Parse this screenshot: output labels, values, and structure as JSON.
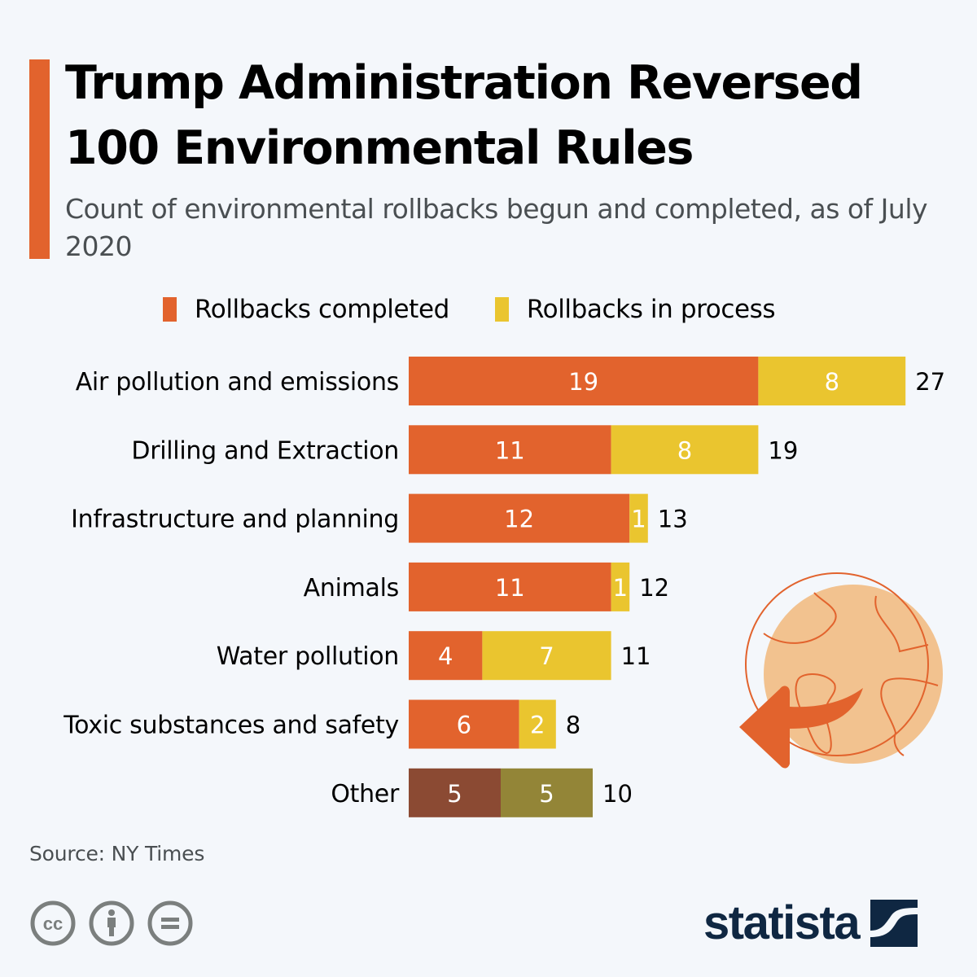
{
  "header": {
    "title": "Trump Administration Reversed 100 Environmental Rules",
    "subtitle": "Count of environmental rollbacks begun and completed, as of July 2020"
  },
  "legend": {
    "items": [
      {
        "label": "Rollbacks completed",
        "color": "#e2632d"
      },
      {
        "label": "Rollbacks in process",
        "color": "#eac52f"
      }
    ]
  },
  "colors": {
    "completed": "#e2632d",
    "in_process": "#eac52f",
    "other_completed": "#8b4a33",
    "other_in_process": "#938537",
    "accent": "#e2632d",
    "globe_fill": "#f2c28f",
    "brand": "#0f2742",
    "cc_gray": "#7b7f7e"
  },
  "chart_data": {
    "type": "bar",
    "orientation": "horizontal",
    "stacked": true,
    "title": "Trump Administration Reversed 100 Environmental Rules",
    "subtitle": "Count of environmental rollbacks begun and completed, as of July 2020",
    "xlabel": "",
    "ylabel": "",
    "categories": [
      "Air pollution and emissions",
      "Drilling and Extraction",
      "Infrastructure and planning",
      "Animals",
      "Water pollution",
      "Toxic substances and safety",
      "Other"
    ],
    "series": [
      {
        "name": "Rollbacks completed",
        "values": [
          19,
          11,
          12,
          11,
          4,
          6,
          5
        ]
      },
      {
        "name": "Rollbacks in process",
        "values": [
          8,
          8,
          1,
          1,
          7,
          2,
          5
        ]
      }
    ],
    "totals": [
      27,
      19,
      13,
      12,
      11,
      8,
      10
    ],
    "xlim": [
      0,
      27
    ],
    "grid": false,
    "legend": "top",
    "special_colors": {
      "Other": [
        "#8b4a33",
        "#938537"
      ]
    }
  },
  "footer": {
    "source": "Source: NY Times",
    "license_icons": [
      "cc-icon",
      "attribution-icon",
      "no-derivatives-icon"
    ],
    "brand": "statista"
  }
}
